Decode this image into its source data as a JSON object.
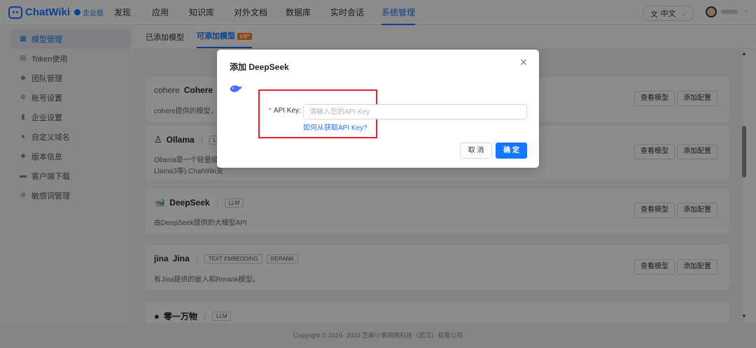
{
  "app": {
    "name": "ChatWiki",
    "edition_badge": "企业版"
  },
  "nav": {
    "items": [
      {
        "label": "发现"
      },
      {
        "label": "应用"
      },
      {
        "label": "知识库"
      },
      {
        "label": "对外文档"
      },
      {
        "label": "数据库"
      },
      {
        "label": "实时会话"
      },
      {
        "label": "系统管理",
        "active": true
      }
    ],
    "language": "中文"
  },
  "sidebar": {
    "items": [
      {
        "label": "模型管理",
        "icon": "grid-icon",
        "active": true
      },
      {
        "label": "Token使用",
        "icon": "token-icon"
      },
      {
        "label": "团队管理",
        "icon": "shield-icon"
      },
      {
        "label": "账号设置",
        "icon": "gear-icon"
      },
      {
        "label": "企业设置",
        "icon": "chart-icon"
      },
      {
        "label": "自定义域名",
        "icon": "pin-icon"
      },
      {
        "label": "版本信息",
        "icon": "info-icon"
      },
      {
        "label": "客户端下载",
        "icon": "monitor-icon"
      },
      {
        "label": "敏感词管理",
        "icon": "filter-icon"
      }
    ]
  },
  "tabs": {
    "added": "已添加模型",
    "available": "可添加模型",
    "vip": "VIP"
  },
  "cards": [
    {
      "name": "Cohere",
      "logo": "cohere",
      "tags": [],
      "desc": "cohere提供的模型，"
    },
    {
      "name": "Ollama",
      "logo": "ollama-icon",
      "tags": [
        "LL"
      ],
      "desc": "Ollama是一个轻量级",
      "desc2": "Llama3等).ChatWiki支"
    },
    {
      "name": "DeepSeek",
      "logo": "whale-icon",
      "tags": [
        "LLM"
      ],
      "desc": "由DeepSeek提供的大模型API"
    },
    {
      "name": "Jina",
      "logo": "jina",
      "tags": [
        "TEXT EMBEDDING",
        "RERANK"
      ],
      "desc": "有Jina提供的嵌入和Rerank模型。"
    },
    {
      "name": "零一万物",
      "logo": "01-icon",
      "tags": [
        "LLM"
      ],
      "desc": ""
    }
  ],
  "card_buttons": {
    "view": "查看模型",
    "add": "添加配置"
  },
  "footer": "Copyright © 2016- 2024 芝麻小事网络科技（武汉）有限公司",
  "dialog": {
    "title": "添加 DeepSeek",
    "field_label": "API Key:",
    "field_placeholder": "请输入您的API Key",
    "help_link": "如何从获取API Key?",
    "cancel": "取 消",
    "confirm": "确 定"
  },
  "colors": {
    "primary": "#1677ff",
    "highlight_box": "#e8212b",
    "vip": "#ff7a1a"
  }
}
